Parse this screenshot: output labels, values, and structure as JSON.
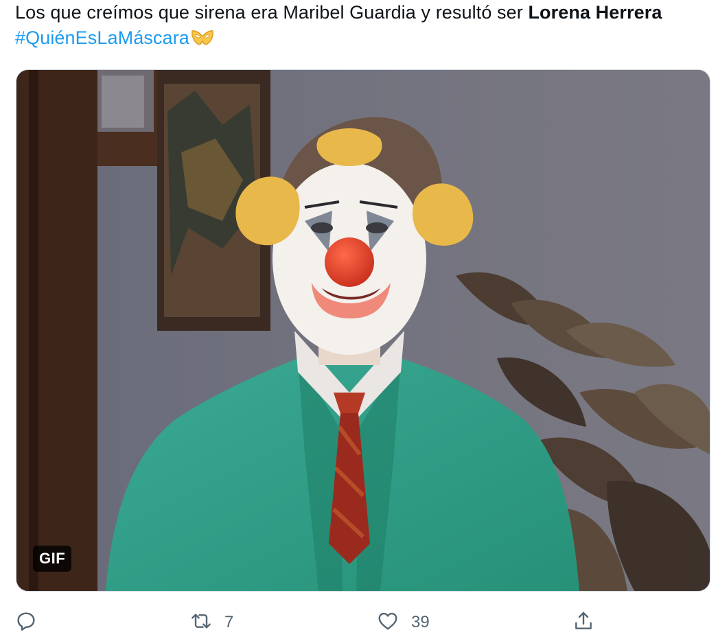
{
  "tweet": {
    "text_plain": "Los que creímos que sirena era Maribel Guardia y resultó ser ",
    "text_bold": "Lorena Herrera",
    "hashtag": "#QuiénEsLaMáscara",
    "hashtag_emoji_icon": "golden-mask-emoji-icon"
  },
  "media": {
    "type": "gif",
    "badge_label": "GIF"
  },
  "actions": {
    "reply": {
      "icon": "reply-icon",
      "count": ""
    },
    "retweet": {
      "icon": "retweet-icon",
      "count": "7"
    },
    "like": {
      "icon": "heart-icon",
      "count": "39"
    },
    "share": {
      "icon": "share-icon"
    }
  },
  "colors": {
    "hashtag": "#1d9bf0",
    "text": "#0f1419",
    "icon": "#536471",
    "gif_badge_bg": "#000000"
  }
}
